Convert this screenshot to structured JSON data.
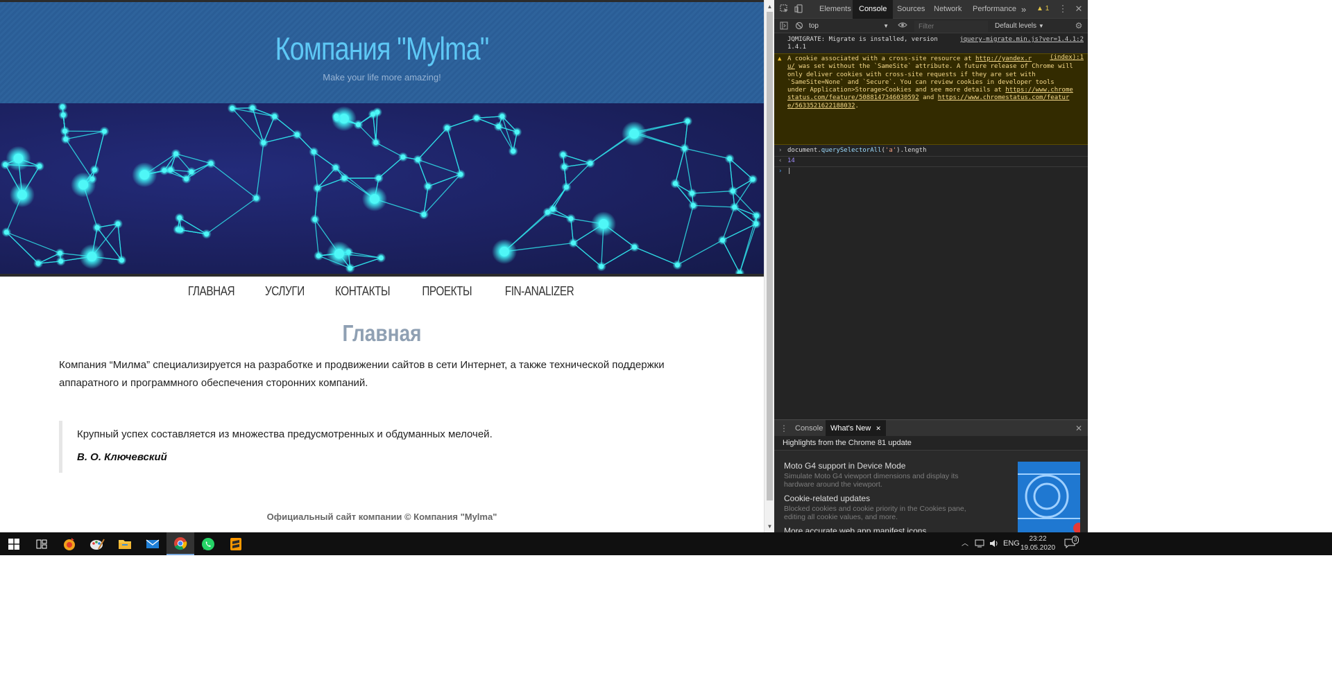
{
  "site": {
    "title": "Компания \"Mylma\"",
    "tagline": "Make your life more amazing!",
    "nav": [
      "ГЛАВНАЯ",
      "УСЛУГИ",
      "КОНТАКТЫ",
      "ПРОЕКТЫ",
      "FIN-ANALIZER"
    ],
    "heading": "Главная",
    "intro": "Компания “Милма” специализируется на разработке и продвижении сайтов в сети Интернет, а также технической поддержки аппаратного и программного обеспечения сторонних компаний.",
    "quote": "Крупный успех составляется из множества предусмотренных и обдуманных мелочей.",
    "quote_author": "В. О. Ключевский",
    "footer": "Официальный сайт компании © Компания \"Mylma\""
  },
  "devtools": {
    "tabs": [
      "Elements",
      "Console",
      "Sources",
      "Network",
      "Performance"
    ],
    "active_tab": "Console",
    "more_tabs": "»",
    "warning_count": "1",
    "context": "top",
    "filter_placeholder": "Filter",
    "levels": "Default levels",
    "messages": {
      "log_text_1": "JQMIGRATE: Migrate is installed, version",
      "log_text_2": "1.4.1",
      "log_source": "jquery-migrate.min.js?ver=1.4.1:2",
      "warn_line1_pre": "A cookie associated with a cross-site resource at ",
      "warn_link1": "http://yandex.r",
      "warn_source": "(index):1",
      "warn_line2_link": "u/",
      "warn_line2": " was set without the `SameSite` attribute. A future release of Chrome will",
      "warn_line3": "only deliver cookies with cross-site requests if they are set with",
      "warn_line4": "`SameSite=None` and `Secure`. You can review cookies in developer tools",
      "warn_line5_pre": "under Application>Storage>Cookies and see more details at ",
      "warn_link2a": "https://www.chrome",
      "warn_link2b": "status.com/feature/5088147346030592",
      "warn_and": " and ",
      "warn_link3a": "https://www.chromestatus.com/featur",
      "warn_link3b": "e/5633521622188032",
      "warn_end": ".",
      "input_pre": "document.",
      "input_fn": "querySelectorAll",
      "input_open": "(",
      "input_str": "'a'",
      "input_close": ").length",
      "result": "14"
    },
    "drawer": {
      "tabs": [
        "Console",
        "What's New"
      ],
      "active": "What's New",
      "header": "Highlights from the Chrome 81 update",
      "items": [
        {
          "title": "Moto G4 support in Device Mode",
          "desc": "Simulate Moto G4 viewport dimensions and display its hardware around the viewport."
        },
        {
          "title": "Cookie-related updates",
          "desc": "Blocked cookies and cookie priority in the Cookies pane, editing all cookie values, and more."
        },
        {
          "title": "More accurate web app manifest icons",
          "desc": ""
        }
      ]
    }
  },
  "taskbar": {
    "language": "ENG",
    "time": "23:22",
    "date": "19.05.2020",
    "notifications": "3",
    "apps": [
      "start-icon",
      "task-view-icon",
      "media-player-icon",
      "paint-icon",
      "file-explorer-icon",
      "mail-icon",
      "chrome-icon",
      "whatsapp-icon",
      "sublime-text-icon"
    ]
  }
}
